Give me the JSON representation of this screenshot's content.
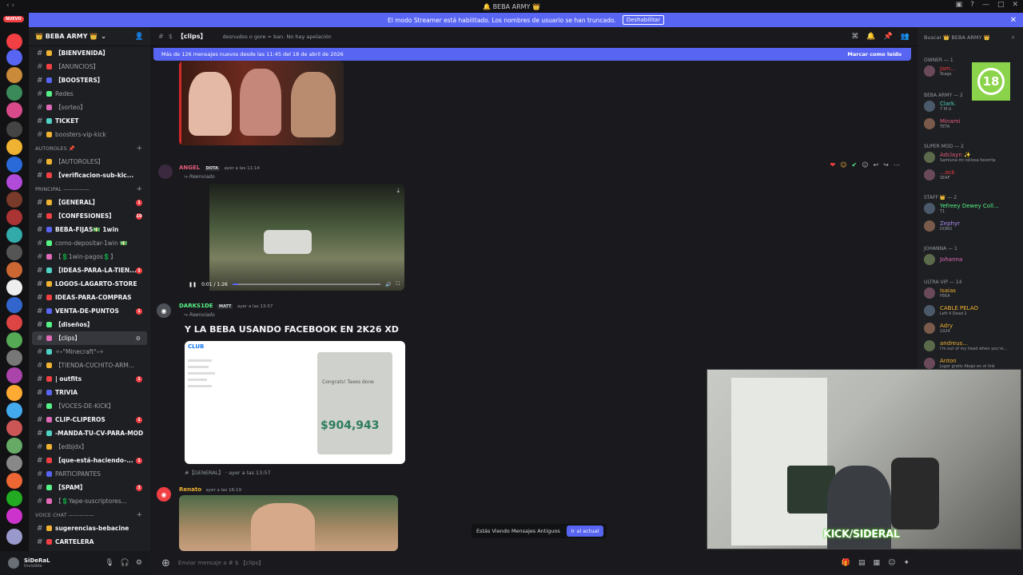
{
  "titlebar": {
    "title": "🔔 BEBA ARMY 👑"
  },
  "banner": {
    "text": "El modo Streamer está habilitado. Los nombres de usuario se han truncado.",
    "button": "Deshabilitar"
  },
  "guild_bar": {
    "new_label": "NUEVO"
  },
  "server": {
    "name": "👑 BEBA ARMY 👑"
  },
  "channels": [
    {
      "label": "【BIENVENIDA】",
      "bold": true
    },
    {
      "label": "【ANUNCIOS】",
      "bold": false
    },
    {
      "label": "【BOOSTERS】",
      "bold": true
    },
    {
      "label": "Redes",
      "bold": false
    },
    {
      "label": "【sorteo】",
      "bold": false
    },
    {
      "label": "TICKET",
      "bold": true
    },
    {
      "label": "boosters-vip-kick",
      "bold": false
    }
  ],
  "category_autoroles": {
    "label": "AUTOROLES 📌"
  },
  "channels_autoroles": [
    {
      "label": "【AUTOROLES】",
      "bold": false
    },
    {
      "label": "【verificacion-sub-kic...",
      "bold": true
    }
  ],
  "category_principal": {
    "label": "PRINCIPAL ————— "
  },
  "channels_principal": [
    {
      "label": "【GENERAL】",
      "bold": true,
      "badge": "1"
    },
    {
      "label": "【CONFESIONES】",
      "bold": true,
      "badge": "10"
    },
    {
      "label": "BEBA-FIJAS💵 1win",
      "bold": true
    },
    {
      "label": "como-depositar-1win 💵",
      "bold": false
    },
    {
      "label": "【💲1win-pagos💲】",
      "bold": false
    },
    {
      "label": "【IDEAS-PARA-LA-TIEN...",
      "bold": true,
      "badge": "1"
    },
    {
      "label": "LOGOS-LAGARTO-STORE",
      "bold": true
    },
    {
      "label": "IDEAS-PARA-COMPRAS",
      "bold": true
    },
    {
      "label": "VENTA-DE-PUNTOS",
      "bold": true,
      "badge": "1"
    },
    {
      "label": "【diseños】",
      "bold": true
    },
    {
      "label": "【clips】",
      "bold": false,
      "active": true
    },
    {
      "label": "✧˖°Minecraft°˖✧",
      "bold": false
    },
    {
      "label": "【TIENDA-CUCHITO-ARM...",
      "bold": false
    },
    {
      "label": "| outfits",
      "bold": true,
      "badge": "1"
    },
    {
      "label": "TRIVIA",
      "bold": true
    },
    {
      "label": "【VOCES-DE-KICK】",
      "bold": false
    },
    {
      "label": "CLIP-CLIPEROS",
      "bold": true,
      "badge": "1"
    },
    {
      "label": "-MANDA-TU-CV-PARA-MOD",
      "bold": true
    },
    {
      "label": "【edbjdx】",
      "bold": false
    },
    {
      "label": "【que-está-haciendo-...",
      "bold": true,
      "badge": "1"
    },
    {
      "label": "PARTICIPANTES",
      "bold": false
    },
    {
      "label": "【SPAM】",
      "bold": true,
      "badge": "3"
    },
    {
      "label": "【💲Yape-suscriptores...",
      "bold": false
    }
  ],
  "category_voice": {
    "label": "VOICE CHAT ————— "
  },
  "channels_voice": [
    {
      "label": "sugerencias-bebacine",
      "bold": true
    },
    {
      "label": "CARTELERA",
      "bold": true
    }
  ],
  "user": {
    "name": "SiDeRaL",
    "status": "Invisible"
  },
  "header": {
    "channel": "【clips】",
    "topic": "desnudos o gore = ban. No hay apelación"
  },
  "new_messages": {
    "text": "Más de 126 mensajes nuevos desde las 11:45 del 18 de abril de 2026",
    "mark": "Marcar como leído"
  },
  "messages": [
    {
      "author": "ANGEL",
      "tag": "DOTA",
      "time": "ayer a las 11:14",
      "forwarded": "Reenviado",
      "video_time": "0:01 / 1:26"
    },
    {
      "author": "DARKS1DE",
      "tag": "MATT",
      "time": "ayer a las 13:57",
      "forwarded": "Reenviado",
      "text": "Y LA BEBA USANDO FACEBOOK EN 2K26 XD",
      "origin": "#【GENERAL】 · ayer a las 13:57"
    },
    {
      "author": "Renato",
      "time": "ayer a las 16:19"
    }
  ],
  "facebook_embed": {
    "logo": "CLUB",
    "amount": "$904,943",
    "caption": "Congrats! Taxes done"
  },
  "old_messages": {
    "text": "Estás Viendo Mensajes Antiguos",
    "button": "Ir al actual"
  },
  "composer": {
    "placeholder": "Enviar mensaje a # $ 【clips】"
  },
  "members": {
    "search": "Buscar 👑 BEBA ARMY 👑",
    "roles": [
      {
        "name": "OWNER — 1"
      },
      {
        "name": "BEBA ARMY — 2"
      },
      {
        "name": "SUPER MOD — 2"
      },
      {
        "name": "STAFF 👑 — 2"
      },
      {
        "name": "Johanna — 1"
      },
      {
        "name": "ULTRA VIP — 14"
      }
    ],
    "list": [
      {
        "name": "Jam...",
        "sub": "Stage",
        "color": "#f23f43"
      },
      {
        "name": "Clark.",
        "sub": "7 M U",
        "color": "#4fd1c5"
      },
      {
        "name": "Minami",
        "sub": "TETA",
        "color": "#e05c7a"
      },
      {
        "name": "Adclayn ✨",
        "sub": "Samluna mi cellosa favorita",
        "color": "#e05c7a"
      },
      {
        "name": "...ock",
        "sub": "SEAF",
        "color": "#f23f43"
      },
      {
        "name": "Yefreey Dewey Coll...",
        "sub": "T1",
        "color": "#57f287"
      },
      {
        "name": "Zephyr",
        "sub": "DORO",
        "color": "#a98cf5"
      },
      {
        "name": "Johanna",
        "sub": "",
        "color": "#e06ab8"
      },
      {
        "name": "Isaias",
        "sub": "FEKA",
        "color": "#f0b232"
      },
      {
        "name": "CABLE PELAO",
        "sub": "Left 4 Dead 2",
        "color": "#f0b232"
      },
      {
        "name": "Adry",
        "sub": "1924",
        "color": "#f0b232"
      },
      {
        "name": "andreus...",
        "sub": "I'm out of my head when you're...",
        "color": "#f0b232"
      },
      {
        "name": "Anton",
        "sub": "Jugar gratis Abajo en el link",
        "color": "#f0b232"
      }
    ]
  },
  "age_badge": {
    "text": "18"
  },
  "webcam": {
    "label": "KICK/SIDERAL"
  }
}
